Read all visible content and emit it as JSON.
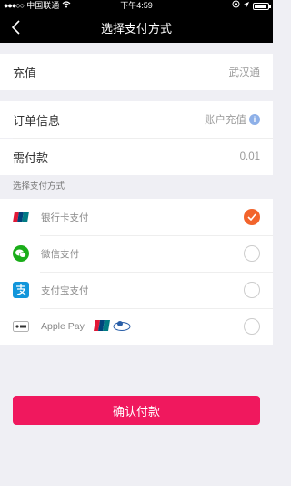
{
  "status_bar": {
    "carrier": "中国联通",
    "time": "下午4:59",
    "battery_level": 0.85
  },
  "nav": {
    "title": "选择支付方式",
    "back_icon": "chevron-left-icon"
  },
  "recharge": {
    "label": "充值",
    "value": "武汉通"
  },
  "order": {
    "label": "订单信息",
    "value": "账户充值",
    "info_icon": "info-icon",
    "info_icon_text": "i"
  },
  "payment_due": {
    "label": "需付款",
    "value": "0.01"
  },
  "methods_section": {
    "label": "选择支付方式",
    "methods": [
      {
        "label": "银行卡支付",
        "icon": "unionpay-icon",
        "selected": true
      },
      {
        "label": "微信支付",
        "icon": "wechat-icon",
        "selected": false
      },
      {
        "label": "支付宝支付",
        "icon": "alipay-icon",
        "selected": false
      },
      {
        "label": "Apple Pay",
        "icon": "apple-pay-icon",
        "selected": false
      }
    ]
  },
  "colors": {
    "accent": "#f0185e",
    "selected_radio": "#f2642c",
    "wechat": "#1aad19",
    "alipay": "#1296db"
  },
  "confirm_button": {
    "label": "确认付款"
  }
}
